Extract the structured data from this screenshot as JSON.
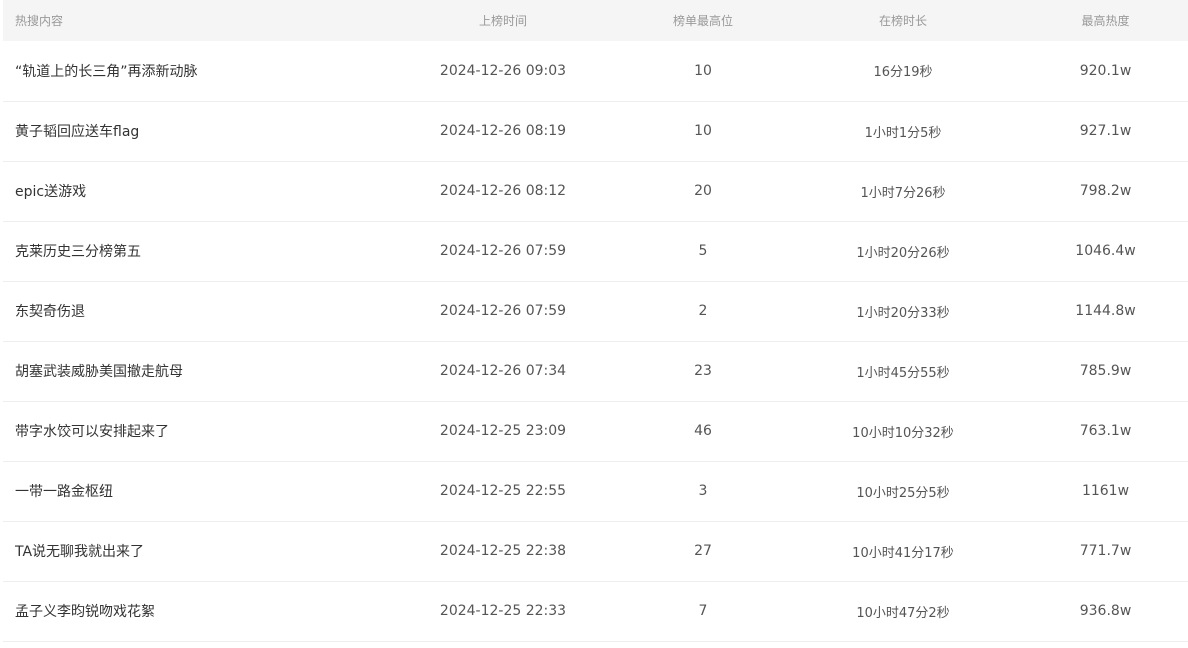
{
  "columns": [
    "热搜内容",
    "上榜时间",
    "榜单最高位",
    "在榜时长",
    "最高热度"
  ],
  "rows": [
    {
      "title": "“轨道上的长三角”再添新动脉",
      "time": "2024-12-26 09:03",
      "rank": "10",
      "duration": "16分19秒",
      "heat": "920.1w"
    },
    {
      "title": "黄子韬回应送车flag",
      "time": "2024-12-26 08:19",
      "rank": "10",
      "duration": "1小时1分5秒",
      "heat": "927.1w"
    },
    {
      "title": "epic送游戏",
      "time": "2024-12-26 08:12",
      "rank": "20",
      "duration": "1小时7分26秒",
      "heat": "798.2w"
    },
    {
      "title": "克莱历史三分榜第五",
      "time": "2024-12-26 07:59",
      "rank": "5",
      "duration": "1小时20分26秒",
      "heat": "1046.4w"
    },
    {
      "title": "东契奇伤退",
      "time": "2024-12-26 07:59",
      "rank": "2",
      "duration": "1小时20分33秒",
      "heat": "1144.8w"
    },
    {
      "title": "胡塞武装威胁美国撤走航母",
      "time": "2024-12-26 07:34",
      "rank": "23",
      "duration": "1小时45分55秒",
      "heat": "785.9w"
    },
    {
      "title": "带字水饺可以安排起来了",
      "time": "2024-12-25 23:09",
      "rank": "46",
      "duration": "10小时10分32秒",
      "heat": "763.1w"
    },
    {
      "title": "一带一路金枢纽",
      "time": "2024-12-25 22:55",
      "rank": "3",
      "duration": "10小时25分5秒",
      "heat": "1161w"
    },
    {
      "title": "TA说无聊我就出来了",
      "time": "2024-12-25 22:38",
      "rank": "27",
      "duration": "10小时41分17秒",
      "heat": "771.7w"
    },
    {
      "title": "孟子义李昀锐吻戏花絮",
      "time": "2024-12-25 22:33",
      "rank": "7",
      "duration": "10小时47分2秒",
      "heat": "936.8w"
    }
  ]
}
